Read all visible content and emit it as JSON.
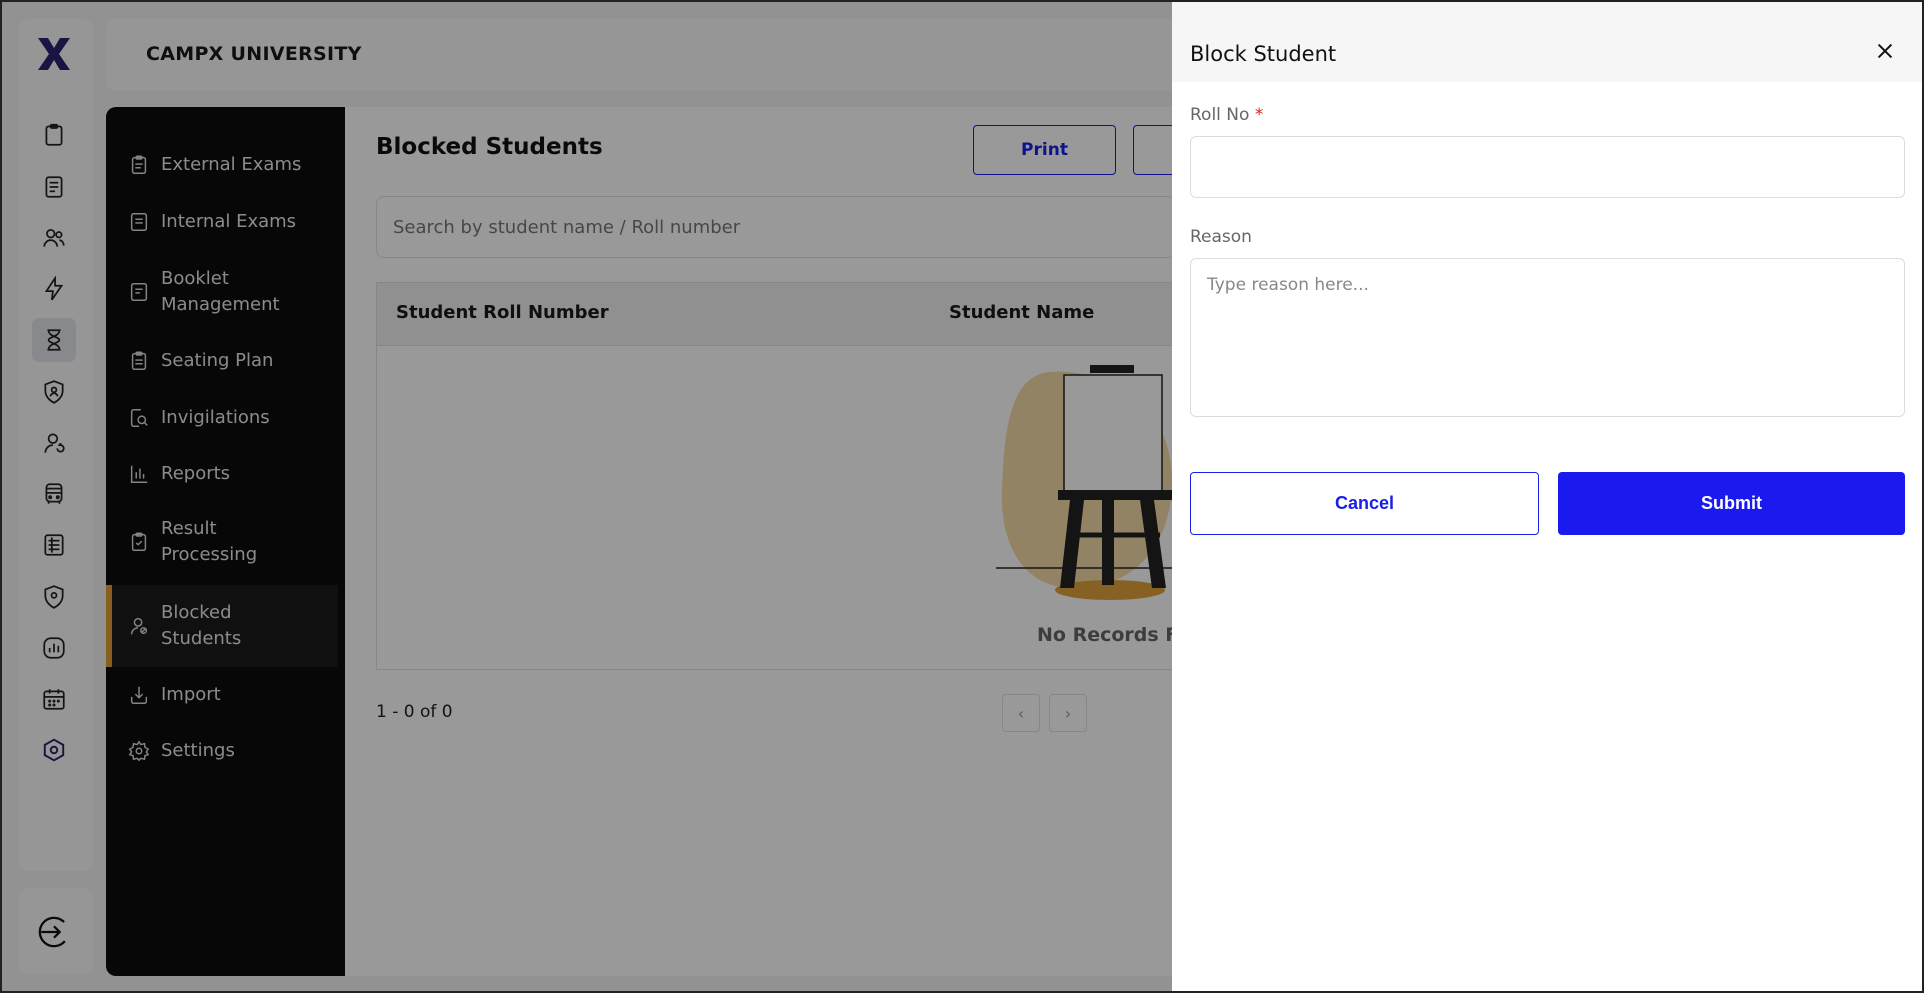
{
  "app": {
    "university": "CAMPX UNIVERSITY",
    "logo_text": "X"
  },
  "rail": {
    "icons": [
      "clipboard-icon",
      "notebook-icon",
      "users-icon",
      "bolt-icon",
      "hourglass-icon",
      "shield-user-icon",
      "user-refresh-icon",
      "bus-icon",
      "ledger-icon",
      "shield-pin-icon",
      "chart-icon",
      "calendar-icon",
      "hexagon-settings-icon"
    ],
    "active_index": 4,
    "logout_icon": "logout-icon"
  },
  "sidebar": {
    "items": [
      {
        "label": "External Exams",
        "icon": "clipboard-icon"
      },
      {
        "label": "Internal Exams",
        "icon": "document-icon"
      },
      {
        "label": "Booklet Management",
        "icon": "booklet-icon"
      },
      {
        "label": "Seating Plan",
        "icon": "clipboard-list-icon"
      },
      {
        "label": "Invigilations",
        "icon": "magnifier-icon"
      },
      {
        "label": "Reports",
        "icon": "bar-chart-icon"
      },
      {
        "label": "Result Processing",
        "icon": "clipboard-check-icon"
      },
      {
        "label": "Blocked Students",
        "icon": "user-block-icon"
      },
      {
        "label": "Import",
        "icon": "import-icon"
      },
      {
        "label": "Settings",
        "icon": "gear-icon"
      }
    ],
    "active_index": 7
  },
  "main": {
    "title": "Blocked Students",
    "print_label": "Print",
    "search_placeholder": "Search by student name / Roll number",
    "columns": [
      "Student Roll Number",
      "Student Name"
    ],
    "empty_text": "No Records Fo",
    "pagination": "1 - 0 of 0"
  },
  "drawer": {
    "title": "Block Student",
    "roll_label": "Roll No",
    "required_mark": "*",
    "roll_value": "",
    "reason_label": "Reason",
    "reason_placeholder": "Type reason here...",
    "cancel_label": "Cancel",
    "submit_label": "Submit"
  },
  "colors": {
    "accent": "#1a1aef",
    "active_marker": "#e0a030",
    "sidebar_bg": "#0c0c0c"
  }
}
